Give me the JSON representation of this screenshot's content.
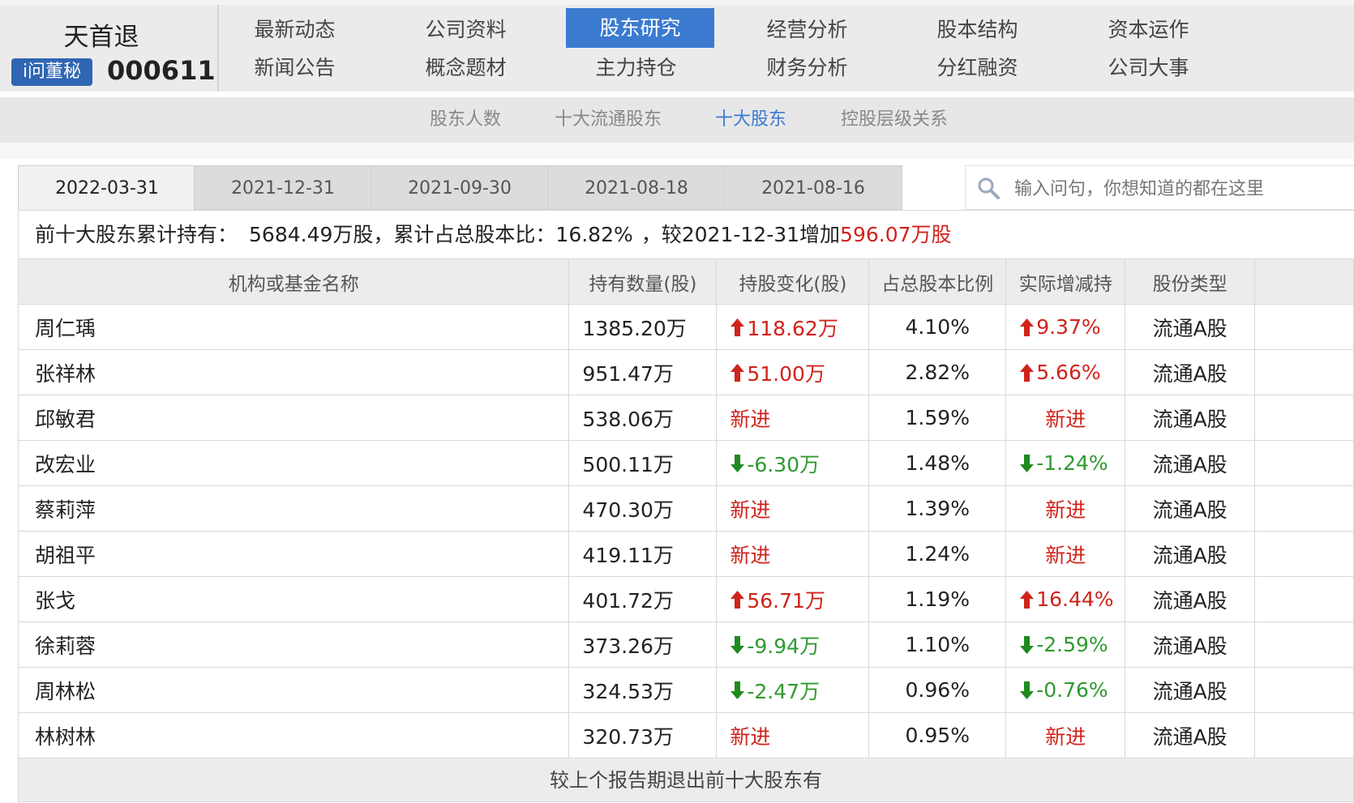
{
  "brand": {
    "stock_name": "天首退",
    "ask_badge": "i问董秘",
    "stock_code": "000611"
  },
  "nav": {
    "row1": [
      "最新动态",
      "公司资料",
      "股东研究",
      "经营分析",
      "股本结构",
      "资本运作"
    ],
    "row2": [
      "新闻公告",
      "概念题材",
      "主力持仓",
      "财务分析",
      "分红融资",
      "公司大事"
    ],
    "active": "股东研究"
  },
  "subnav": {
    "items": [
      "股东人数",
      "十大流通股东",
      "十大股东",
      "控股层级关系"
    ],
    "active": "十大股东"
  },
  "date_tabs": {
    "items": [
      "2022-03-31",
      "2021-12-31",
      "2021-09-30",
      "2021-08-18",
      "2021-08-16"
    ],
    "active": "2022-03-31"
  },
  "search": {
    "placeholder": "输入问句，你想知道的都在这里"
  },
  "summary": {
    "label": "前十大股东累计持有：",
    "total_shares": "5684.49万股，",
    "ratio_label": "累计占总股本比：",
    "ratio": "16.82%",
    "compare_text": "，较2021-12-31增加",
    "increase": "596.07万股"
  },
  "table": {
    "headers": [
      "机构或基金名称",
      "持有数量(股)",
      "持股变化(股)",
      "占总股本比例",
      "实际增减持",
      "股份类型"
    ],
    "rows": [
      {
        "name": "周仁瑀",
        "shares": "1385.20万",
        "change": "118.62万",
        "change_dir": "up",
        "ratio": "4.10%",
        "actual": "9.37%",
        "actual_dir": "up",
        "type": "流通A股"
      },
      {
        "name": "张祥林",
        "shares": "951.47万",
        "change": "51.00万",
        "change_dir": "up",
        "ratio": "2.82%",
        "actual": "5.66%",
        "actual_dir": "up",
        "type": "流通A股"
      },
      {
        "name": "邱敏君",
        "shares": "538.06万",
        "change": "新进",
        "change_dir": "new",
        "ratio": "1.59%",
        "actual": "新进",
        "actual_dir": "new",
        "type": "流通A股"
      },
      {
        "name": "改宏业",
        "shares": "500.11万",
        "change": "-6.30万",
        "change_dir": "down",
        "ratio": "1.48%",
        "actual": "-1.24%",
        "actual_dir": "down",
        "type": "流通A股"
      },
      {
        "name": "蔡莉萍",
        "shares": "470.30万",
        "change": "新进",
        "change_dir": "new",
        "ratio": "1.39%",
        "actual": "新进",
        "actual_dir": "new",
        "type": "流通A股"
      },
      {
        "name": "胡祖平",
        "shares": "419.11万",
        "change": "新进",
        "change_dir": "new",
        "ratio": "1.24%",
        "actual": "新进",
        "actual_dir": "new",
        "type": "流通A股"
      },
      {
        "name": "张戈",
        "shares": "401.72万",
        "change": "56.71万",
        "change_dir": "up",
        "ratio": "1.19%",
        "actual": "16.44%",
        "actual_dir": "up",
        "type": "流通A股"
      },
      {
        "name": "徐莉蓉",
        "shares": "373.26万",
        "change": "-9.94万",
        "change_dir": "down",
        "ratio": "1.10%",
        "actual": "-2.59%",
        "actual_dir": "down",
        "type": "流通A股"
      },
      {
        "name": "周林松",
        "shares": "324.53万",
        "change": "-2.47万",
        "change_dir": "down",
        "ratio": "0.96%",
        "actual": "-0.76%",
        "actual_dir": "down",
        "type": "流通A股"
      },
      {
        "name": "林树林",
        "shares": "320.73万",
        "change": "新进",
        "change_dir": "new",
        "ratio": "0.95%",
        "actual": "新进",
        "actual_dir": "new",
        "type": "流通A股"
      }
    ]
  },
  "footer": {
    "text": "较上个报告期退出前十大股东有"
  },
  "colors": {
    "accent": "#3a7bd0",
    "up": "#d0231b",
    "down": "#2f9a2f"
  }
}
